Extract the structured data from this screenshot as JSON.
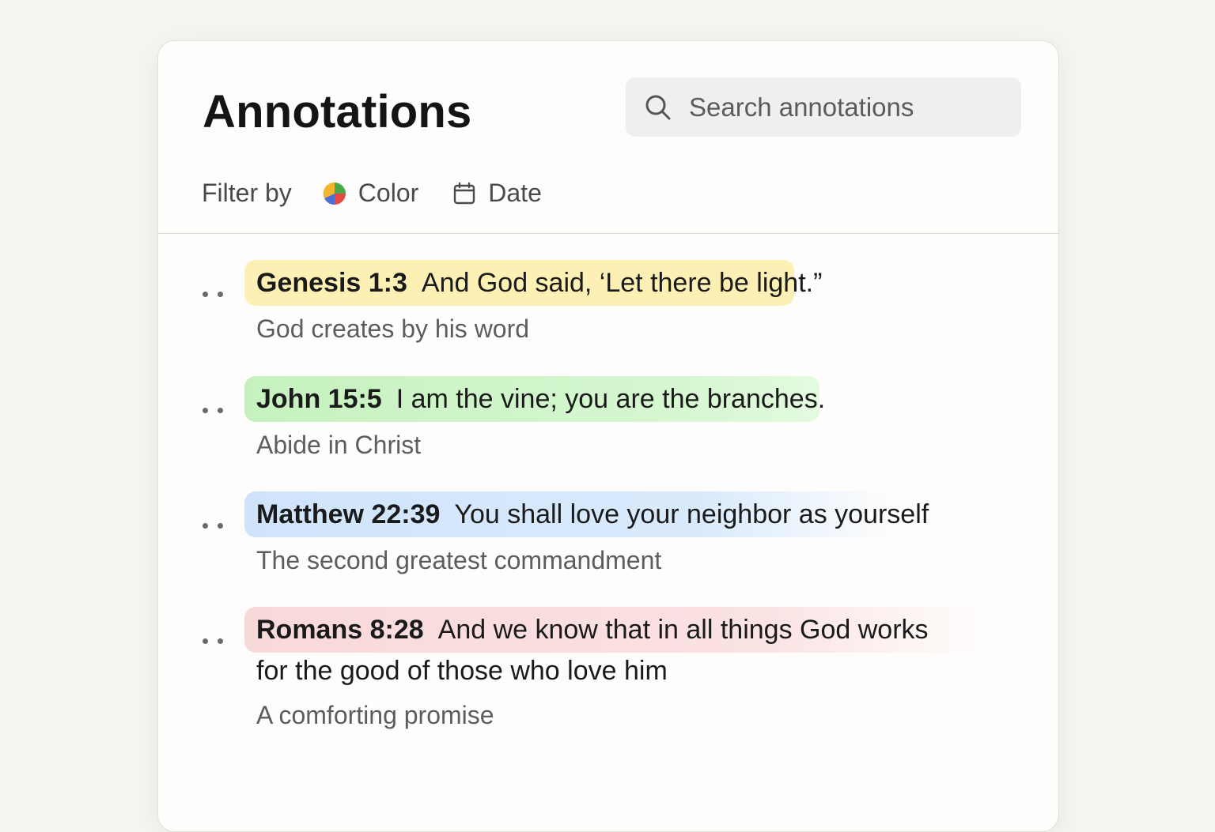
{
  "header": {
    "title": "Annotations",
    "search": {
      "placeholder": "Search annotations",
      "icon": "search-icon"
    }
  },
  "filters": {
    "label": "Filter by",
    "color": {
      "label": "Color",
      "icon": "color-wheel-icon"
    },
    "date": {
      "label": "Date",
      "icon": "calendar-icon"
    }
  },
  "annotations": [
    {
      "reference": "Genesis 1:3",
      "text": "And God said, ‘Let there be light.”",
      "note": "God creates by his word",
      "highlight_color": "#fdf0b4"
    },
    {
      "reference": "John 15:5",
      "text": "I am the vine; you are the branches.",
      "note": "Abide in Christ",
      "highlight_color": "#cdf4c6"
    },
    {
      "reference": "Matthew 22:39",
      "text": "You shall love your neighbor as yourself",
      "note": "The second greatest commandment",
      "highlight_color": "#d3e6fb"
    },
    {
      "reference": "Romans 8:28",
      "text": "And we know that in all things God works",
      "text_continued": "for the good of those who love him",
      "note": "A comforting promise",
      "highlight_color": "#f9dcdc"
    }
  ]
}
